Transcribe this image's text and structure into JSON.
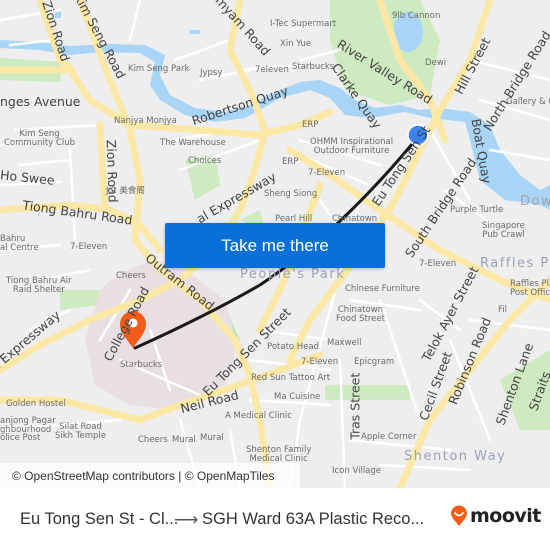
{
  "map": {
    "colors": {
      "background": "#eeeeef",
      "major_road": "#fbe8a6",
      "minor_road": "#ffffff",
      "water": "#a8d4f5",
      "park": "#cdeac0",
      "hospital_area": "#e8dfe3",
      "route_line": "#1a1a1a",
      "origin_marker": "#3d82ef",
      "destination_marker": "#f25c19"
    },
    "roads": [
      "Zion Road",
      "Kim Seng Road",
      "Mohamed Sultan Road (…myam Road)",
      "River Valley Road",
      "Clarke Quay",
      "Hill Street",
      "North Bridge Road",
      "Robertson Quay",
      "Havelock... Avenue (…nges Avenue)",
      "Zion Road",
      "Ho Swee",
      "Tiong Bahru Road",
      "Central Expressway",
      "Eu Tong Sen Street",
      "South Bridge Road",
      "Boat Quay",
      "Outram Road",
      "College Road",
      "Eu Tong Sen Street",
      "Neil Road",
      "Telok Ayer Street",
      "Cecil Street",
      "Robinson Road",
      "Shenton Lane",
      "Tras Street",
      "Straits..."
    ],
    "labels": {
      "zion_road_top": "Zion Road",
      "kim_seng_road": "Kim Seng Road",
      "myam_road": "myam Road",
      "itec": "I-Tec Supermart",
      "xin_yue": "Xin Yue",
      "cannon": "9lb Cannon",
      "river_valley": "River Valley Road",
      "hill_street": "Hill Street",
      "north_bridge": "North Bridge Road",
      "kim_seng_park": "Kim Seng Park",
      "jypsy": "Jypsy",
      "seven_eleven_1": "7eleven",
      "starbucks_1": "Starbucks",
      "clarke_quay": "Clarke Quay",
      "dewi": "Dewi",
      "ages_avenue": "nges Avenue",
      "robertson_quay": "Robertson Quay",
      "nanjya": "Nanjya Monjya",
      "gallery": "Gallery & Co",
      "kim_seng_cc": "Kim Seng\nCommunity Club",
      "zion_road_mid": "Zion Road",
      "the_warehouse": "The Warehouse",
      "erp_1": "ERP",
      "ohmm": "OHMM Inspirational\nOutdoor Furniture",
      "eu_tong_sen_top": "Eu Tong Sen St",
      "boat_quay": "Boat Quay",
      "choices": "Choices",
      "erp_2": "ERP",
      "ho_swee": "Ho Swee",
      "seven_eleven_2": "7-Eleven",
      "south_bridge": "South Bridge Road",
      "j2": "J.2 美食阁",
      "expressway_1": "al Expressway",
      "sheng_siong": "Sheng Siong",
      "downtown": "Dow",
      "tiong_bahru_road": "Tiong Bahru Road",
      "purple_turtle": "Purple Turtle",
      "pearl_hill": "Pearl Hill",
      "chinatown": "Chinatown",
      "tb_centre": "Bahru\nal Centre",
      "singapore_pub": "Singapore\nPub Crawl",
      "seven_eleven_3": "7-Eleven",
      "peoples_park": "People's Park",
      "seven_eleven_4": "7-Eleven",
      "raffles_place": "Raffles Pla",
      "tb_air": "Tiong Bahru Air\nRaid Shelter",
      "cheers_1": "Cheers",
      "outram_road": "Outram Road",
      "raffles_post": "Raffles Pla\nPost Offic",
      "chinese_furniture": "Chinese Furniture",
      "expressway_2": "al Expressway",
      "college_road": "College Road",
      "fil": "Fil",
      "chinatown_food": "Chinatown\nFood Street",
      "eu_tong_sen_bottom": "Eu Tong Sen Street",
      "telok_ayer": "Telok Ayer Street",
      "potato_head": "Potato Head",
      "maxwell": "Maxwell",
      "starbucks_2": "Starbucks",
      "seven_eleven_5": "7-Eleven",
      "epicgram": "Epicgram",
      "robinson_road": "Robinson Road",
      "red_sun": "Red Sun Tattoo Art",
      "cecil_street": "Cecil Street",
      "shenton_lane": "Shenton Lane",
      "golden_hostel": "Golden Hostel",
      "neil_road": "Neil Road",
      "ma_cuisine": "Ma Cuisine",
      "tras_street": "Tras Street",
      "straits": "Straits",
      "tanjong_pagar": "anjong Pagar\nghbourhood\nolice Post",
      "silat_road": "Silat Road\nSikh Temple",
      "medical_clinic": "A Medical Clinic",
      "apple_corner": "Apple Corner",
      "cheers_2": "Cheers",
      "mural_1": "Mural",
      "mural_2": "Mural",
      "shenton_family": "Shenton Family\nMedical Clinic",
      "shenton_way": "Shenton Way",
      "icon_village": "Icon Village"
    },
    "origin": "Eu Tong Sen St - Clarke Quay",
    "destination": "Starbucks"
  },
  "cta": {
    "label": "Take me there"
  },
  "attribution": {
    "osm": "© OpenStreetMap contributors",
    "separator": " | ",
    "omt": "© OpenMapTiles"
  },
  "footer": {
    "from": "Eu Tong Sen St - Cl...",
    "arrow": "⟶",
    "to": "SGH Ward 63A Plastic Reco...",
    "brand": "moovit",
    "brand_color": "#f25c19"
  }
}
